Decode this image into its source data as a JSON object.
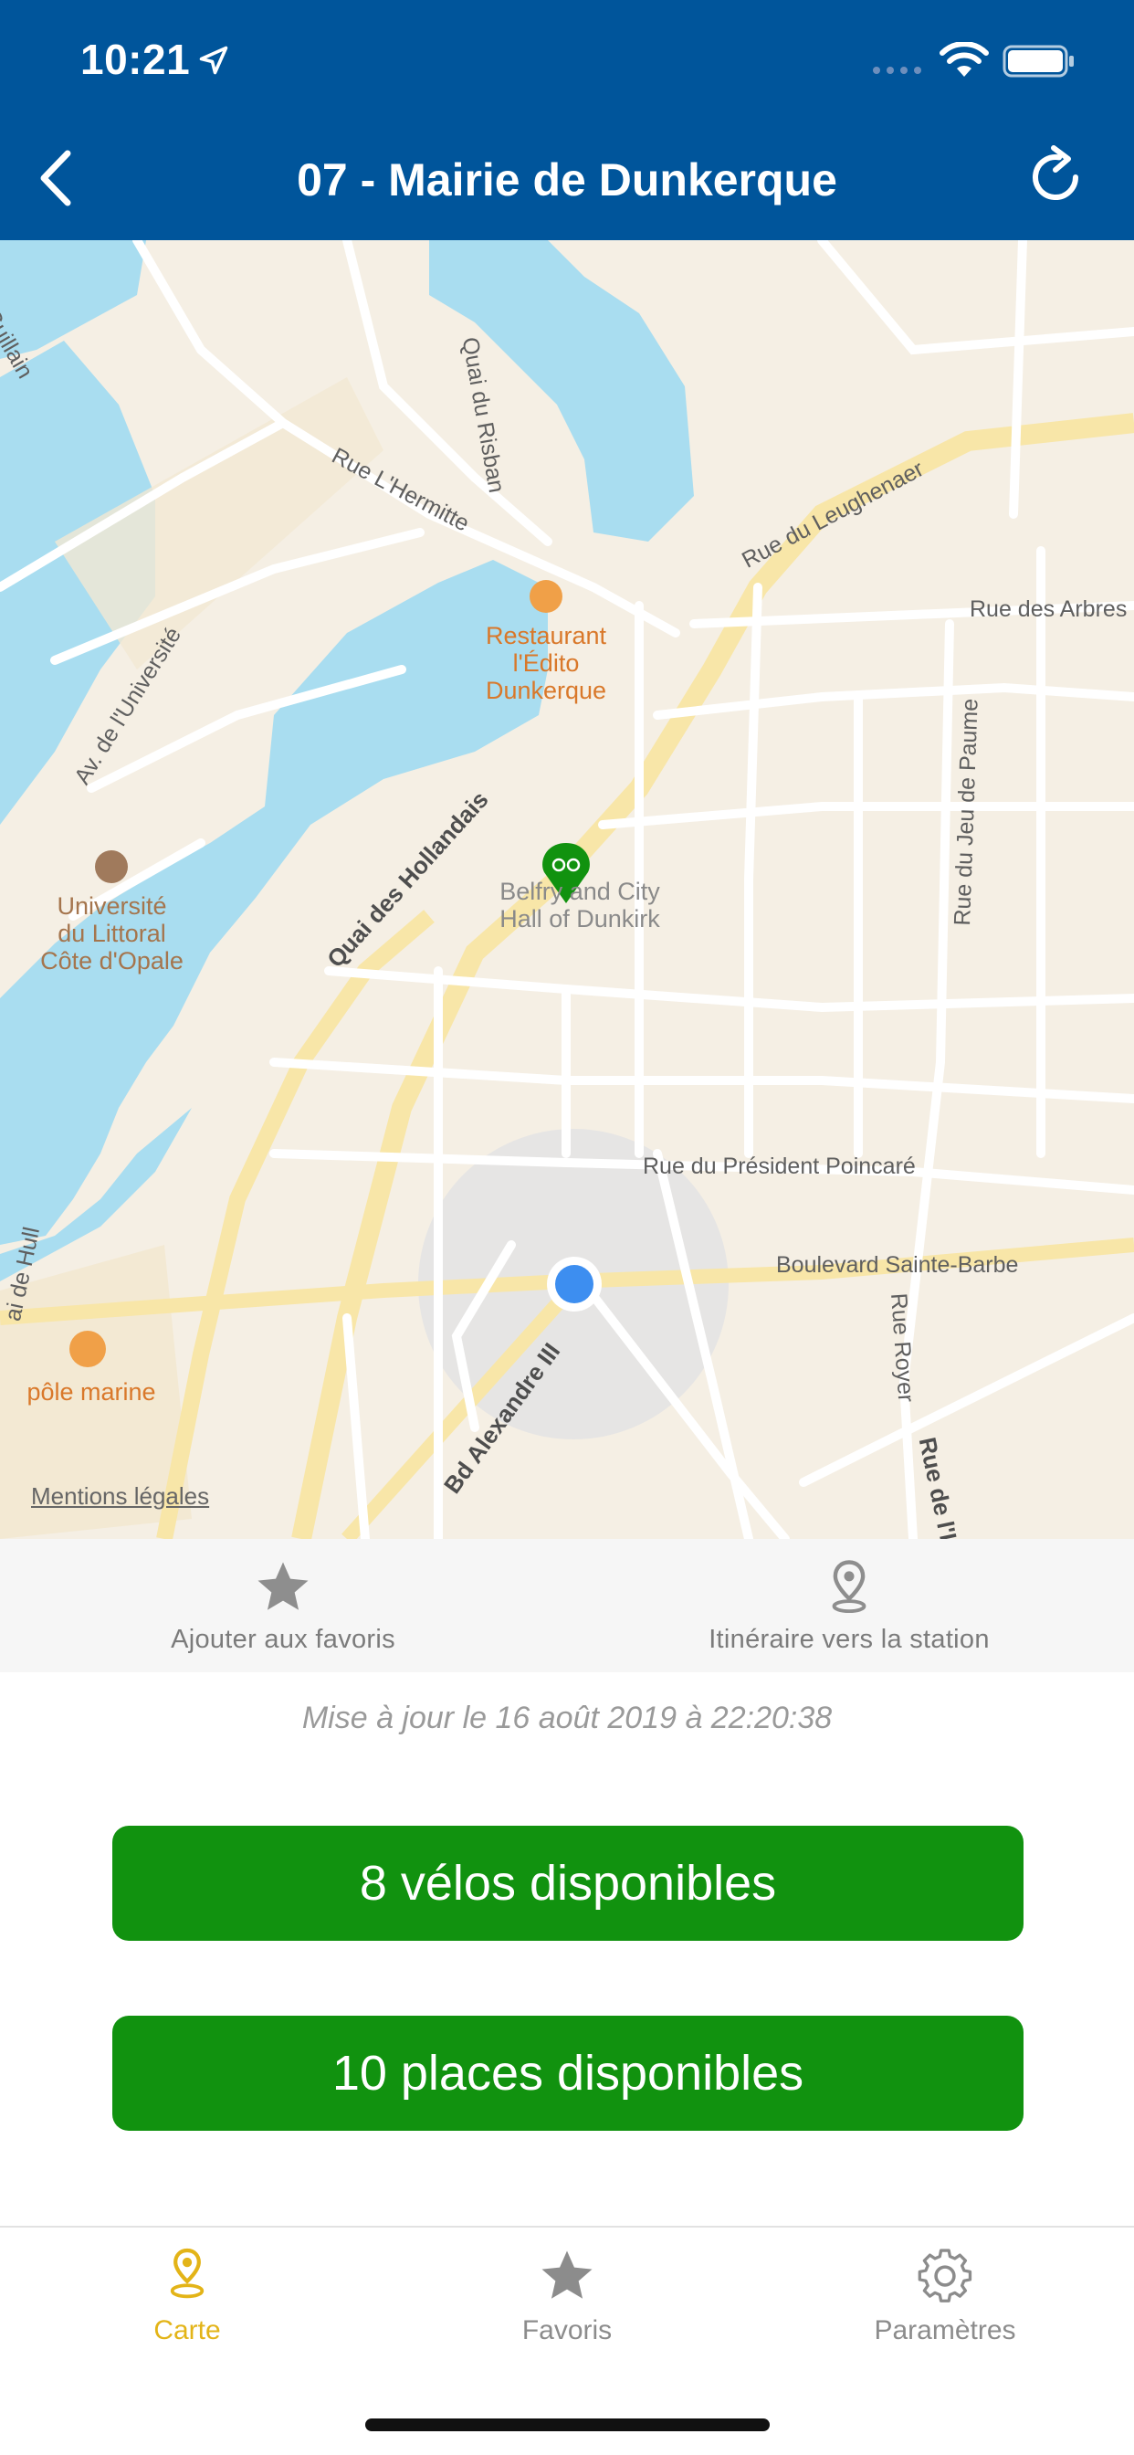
{
  "status_bar": {
    "time": "10:21"
  },
  "header": {
    "title": "07 - Mairie de Dunkerque"
  },
  "map": {
    "street_labels": [
      "Guillain",
      "Quai du Risban",
      "Rue L'Hermitte",
      "Rue du Leughenaer",
      "Rue des Arbres",
      "Av. de l'Université",
      "Quai des Hollandais",
      "Rue du Jeu de Paume",
      "Rue du Président Poincaré",
      "Boulevard Sainte-Barbe",
      "Rue Royer",
      "Bd Alexandre III",
      "ai de Hull",
      "Rue de l'I"
    ],
    "pois": {
      "restaurant": "Restaurant\nl'Édito\nDunkerque",
      "university": "Université\ndu Littoral\nCôte d'Opale",
      "belfry": "Belfry and City\nHall of Dunkirk",
      "pole": "pôle marine"
    },
    "legal": "Mentions légales"
  },
  "actions": {
    "favorite": "Ajouter aux favoris",
    "itinerary": "Itinéraire vers la station"
  },
  "update_text": "Mise à jour le 16 août 2019 à 22:20:38",
  "availability": {
    "bikes": "8 vélos disponibles",
    "docks": "10 places disponibles"
  },
  "tabs": {
    "map": "Carte",
    "favorites": "Favoris",
    "settings": "Paramètres"
  },
  "colors": {
    "header": "#00559b",
    "available": "#11920f",
    "active_tab": "#e3b418",
    "water": "#a9ddf0"
  }
}
